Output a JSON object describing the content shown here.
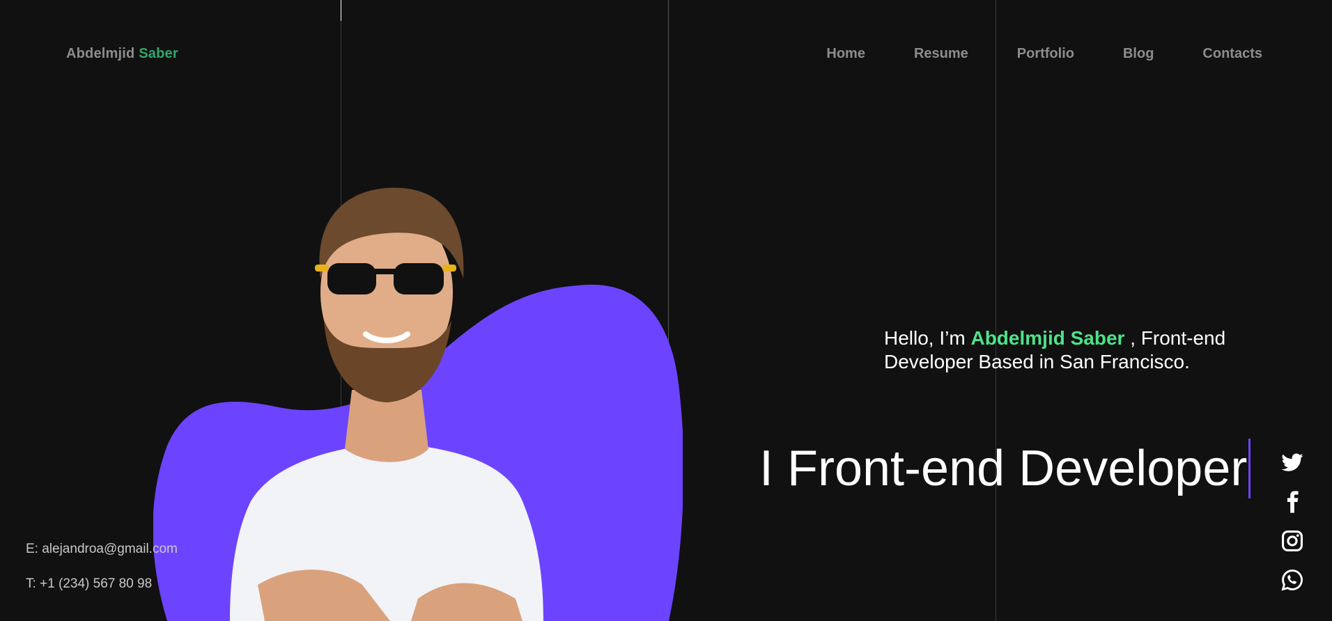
{
  "header": {
    "logo_first": "Abdelmjid",
    "logo_second": "Saber",
    "nav": [
      {
        "label": "Home"
      },
      {
        "label": "Resume"
      },
      {
        "label": "Portfolio"
      },
      {
        "label": "Blog"
      },
      {
        "label": "Contacts"
      }
    ]
  },
  "hero": {
    "intro_prefix": "Hello, I’m",
    "intro_name": "Abdelmjid Saber",
    "intro_suffix": ", Front-end Developer Based in San Francisco.",
    "headline": "I Front-end Developer"
  },
  "contact": {
    "email": "E: alejandroa@gmail.com",
    "phone": "T: +1 (234) 567 80 98"
  },
  "social": [
    "twitter-icon",
    "facebook-icon",
    "instagram-icon",
    "whatsapp-icon"
  ],
  "colors": {
    "background": "#111111",
    "accent_green": "#4ee28a",
    "logo_green": "#2fa86b",
    "blob_purple": "#6c44ff",
    "nav_gray": "#8d8d8d"
  }
}
